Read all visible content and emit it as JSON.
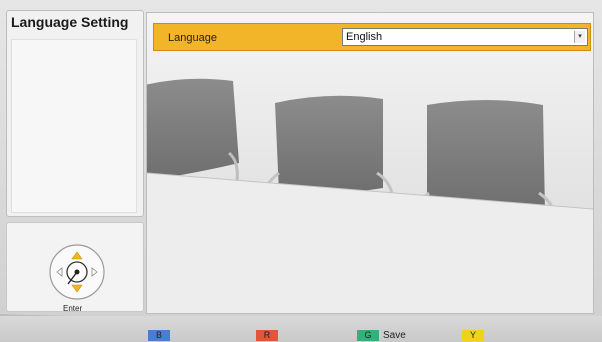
{
  "sidebar": {
    "title": "Language Setting"
  },
  "navigation": {
    "enter_label": "Enter"
  },
  "setting": {
    "label": "Language",
    "value": "English"
  },
  "function_keys": {
    "b_label": "B",
    "r_label": "R",
    "g_label": "G",
    "g_action": "Save",
    "y_label": "Y"
  },
  "colors": {
    "highlight_row": "#f2b428",
    "key_b": "#4a7fd0",
    "key_r": "#e2553a",
    "key_g": "#35b07a",
    "key_y": "#f1d21a"
  },
  "icons": {
    "dpad": "dpad-icon",
    "dropdown": "dropdown-arrow-icon"
  }
}
